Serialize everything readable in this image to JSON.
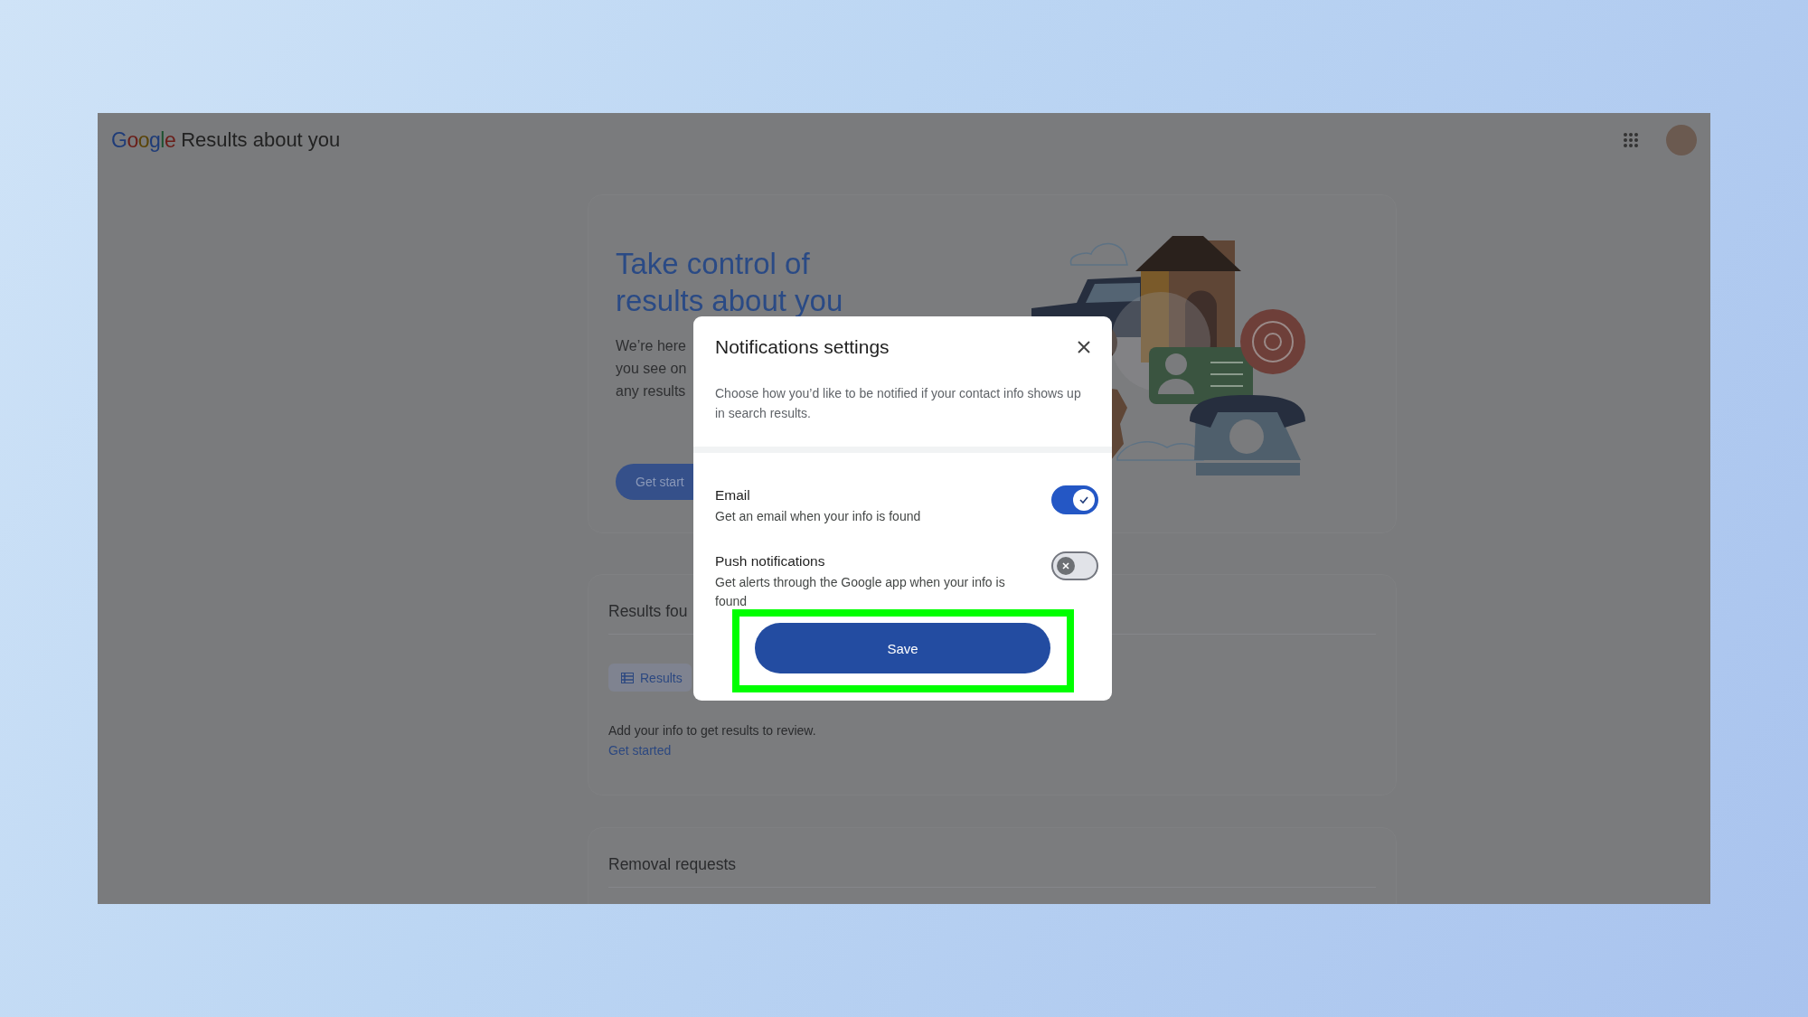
{
  "header": {
    "logo": "Google",
    "title": "Results about you"
  },
  "hero": {
    "title_lines": [
      "Take control of",
      "results about you"
    ],
    "paragraph_lines": [
      "We’re here",
      "you see on",
      "any results"
    ],
    "button": "Get start"
  },
  "results_card": {
    "title": "Results fou",
    "tab": {
      "label": "Results",
      "selected": true
    },
    "message": "Add your info to get results to review.",
    "link": "Get started"
  },
  "removal_card": {
    "title": "Removal requests"
  },
  "dialog": {
    "title": "Notifications settings",
    "description": "Choose how you’d like to be notified if your contact info shows up in search results.",
    "options": [
      {
        "label": "Email",
        "description": "Get an email when your info is found",
        "on": true
      },
      {
        "label": "Push notifications",
        "description": "Get alerts through the Google app when your info is found",
        "on": false
      }
    ],
    "save_button": "Save",
    "highlighted": true
  }
}
